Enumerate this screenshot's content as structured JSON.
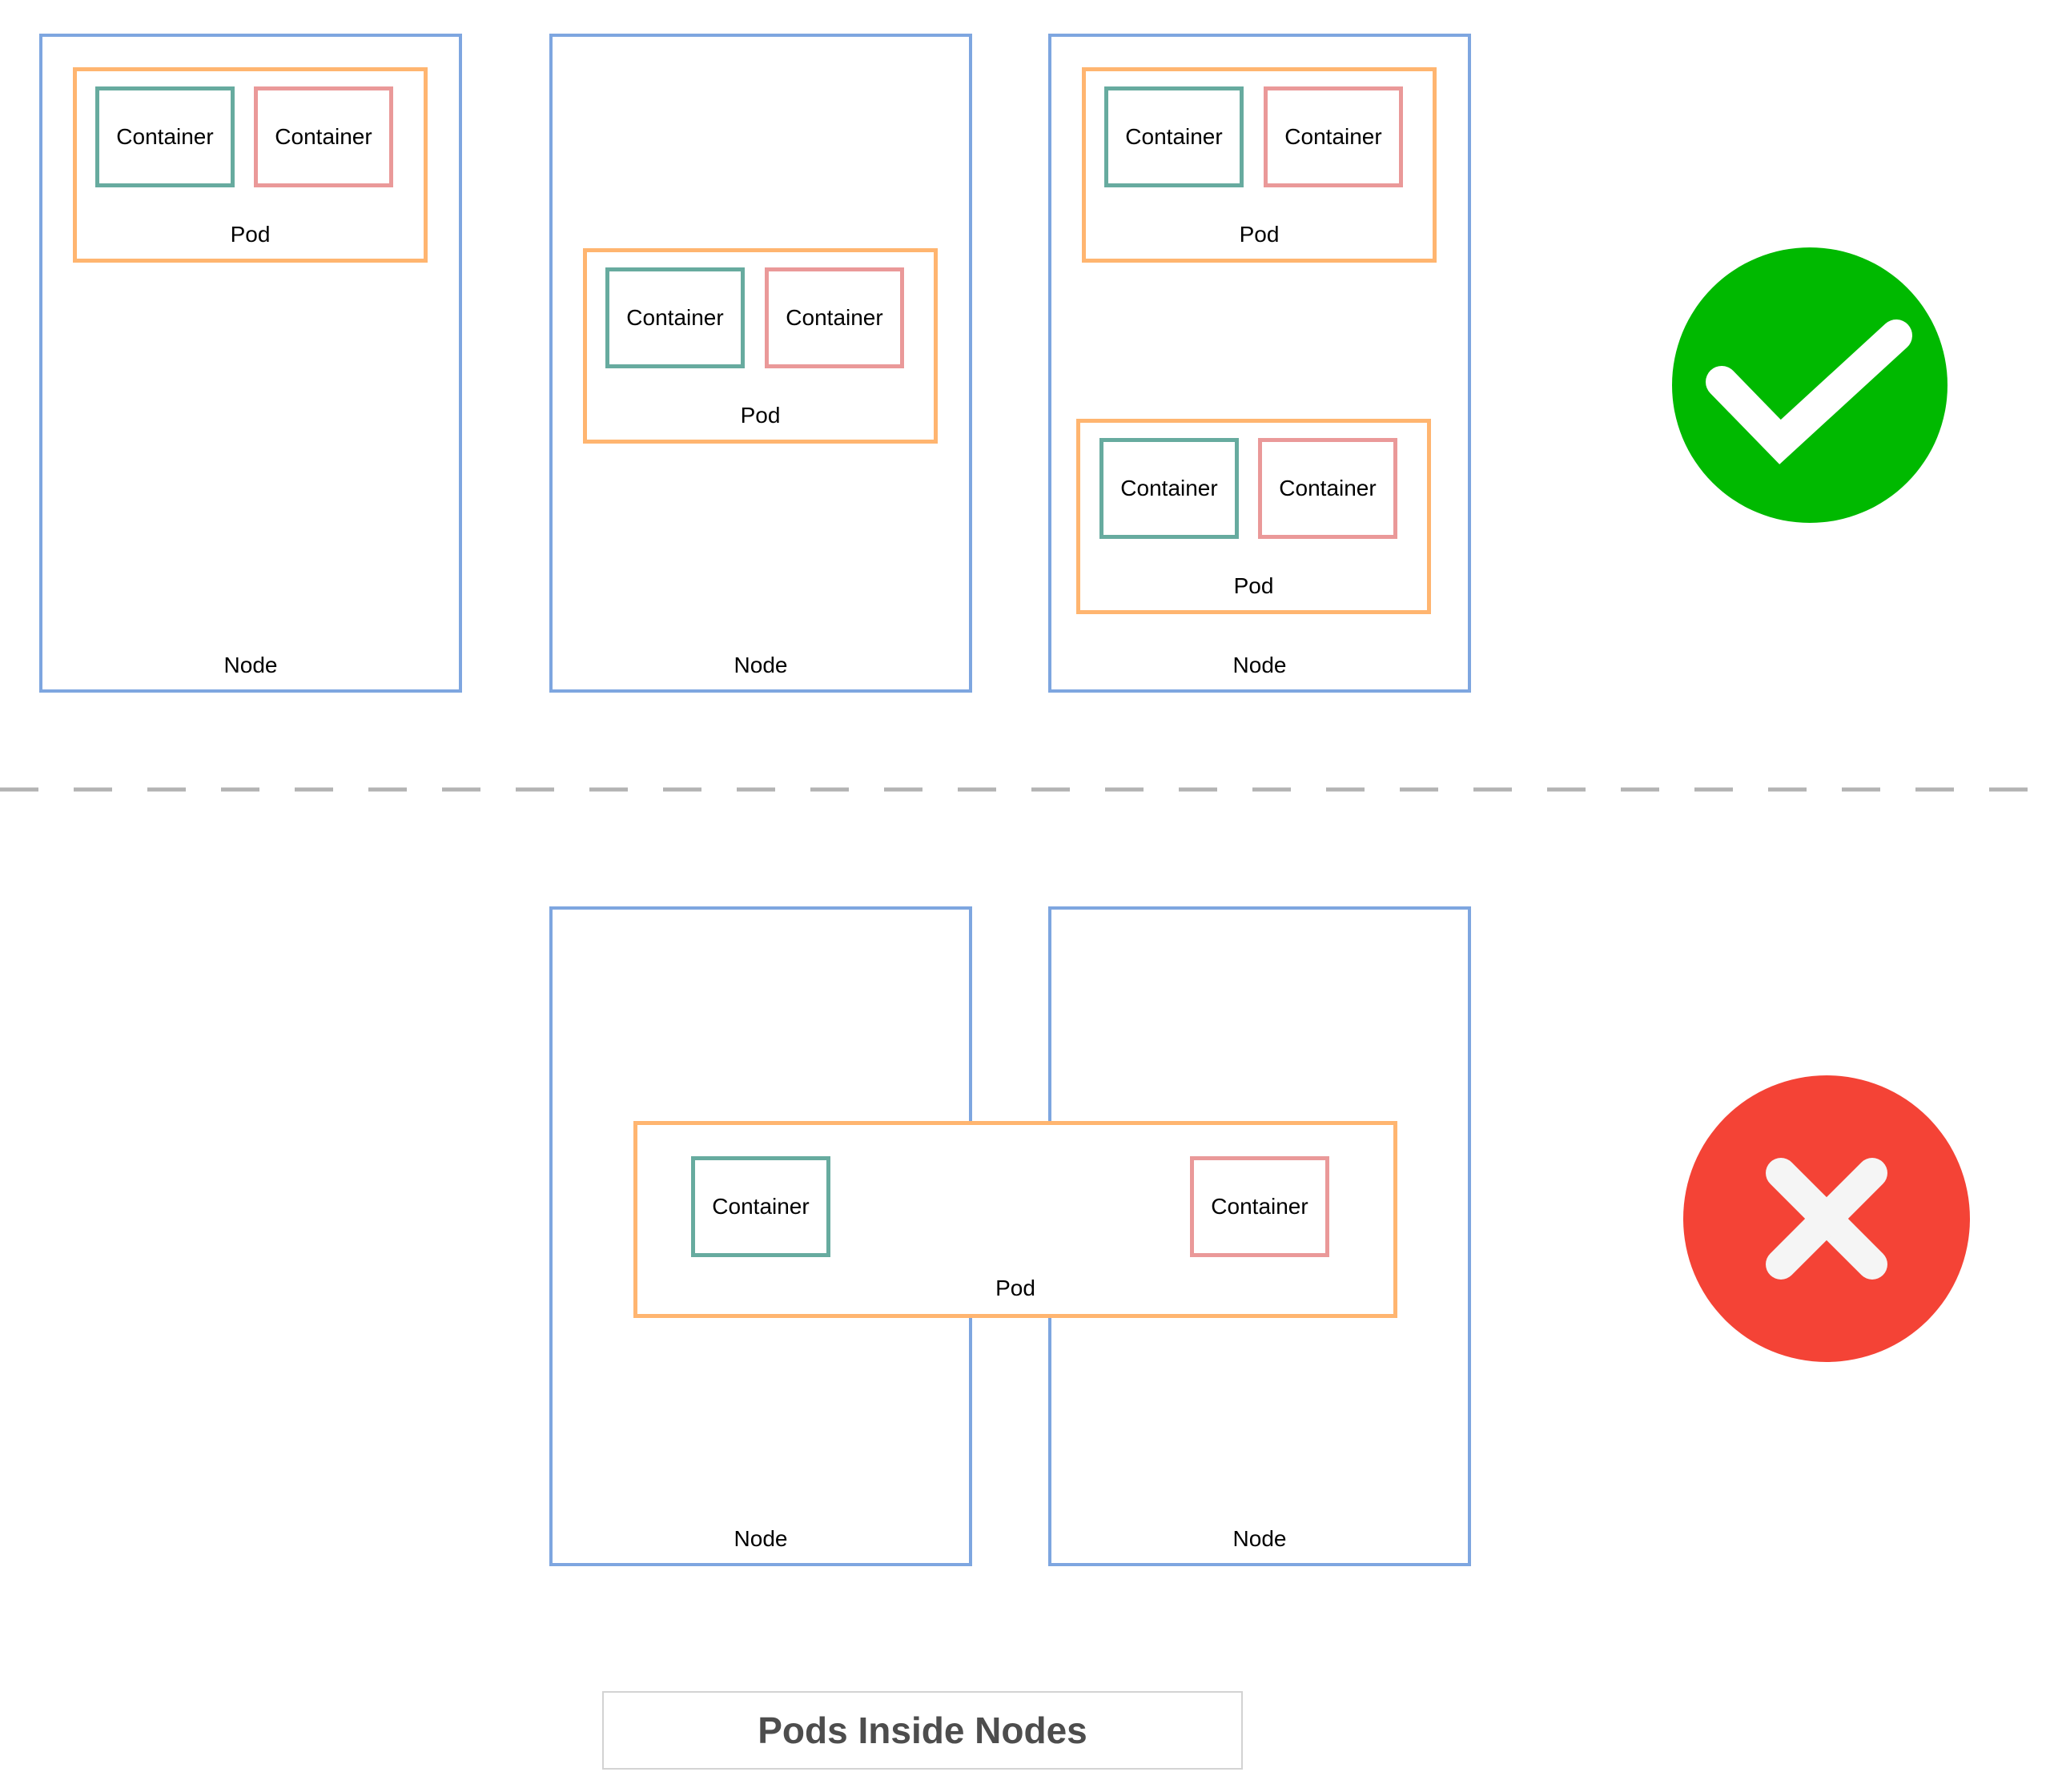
{
  "labels": {
    "container": "Container",
    "pod": "Pod",
    "node": "Node"
  },
  "status": {
    "valid_icon": "check-circle-icon",
    "invalid_icon": "x-circle-icon",
    "valid_color": "#00b900",
    "invalid_color": "#f44336"
  },
  "colors": {
    "node_border": "#7ea6e0",
    "pod_border": "#ffb570",
    "container_a_border": "#67ab9f",
    "container_b_border": "#ea9999",
    "divider": "#b3b3b3"
  },
  "caption": "Pods Inside Nodes"
}
